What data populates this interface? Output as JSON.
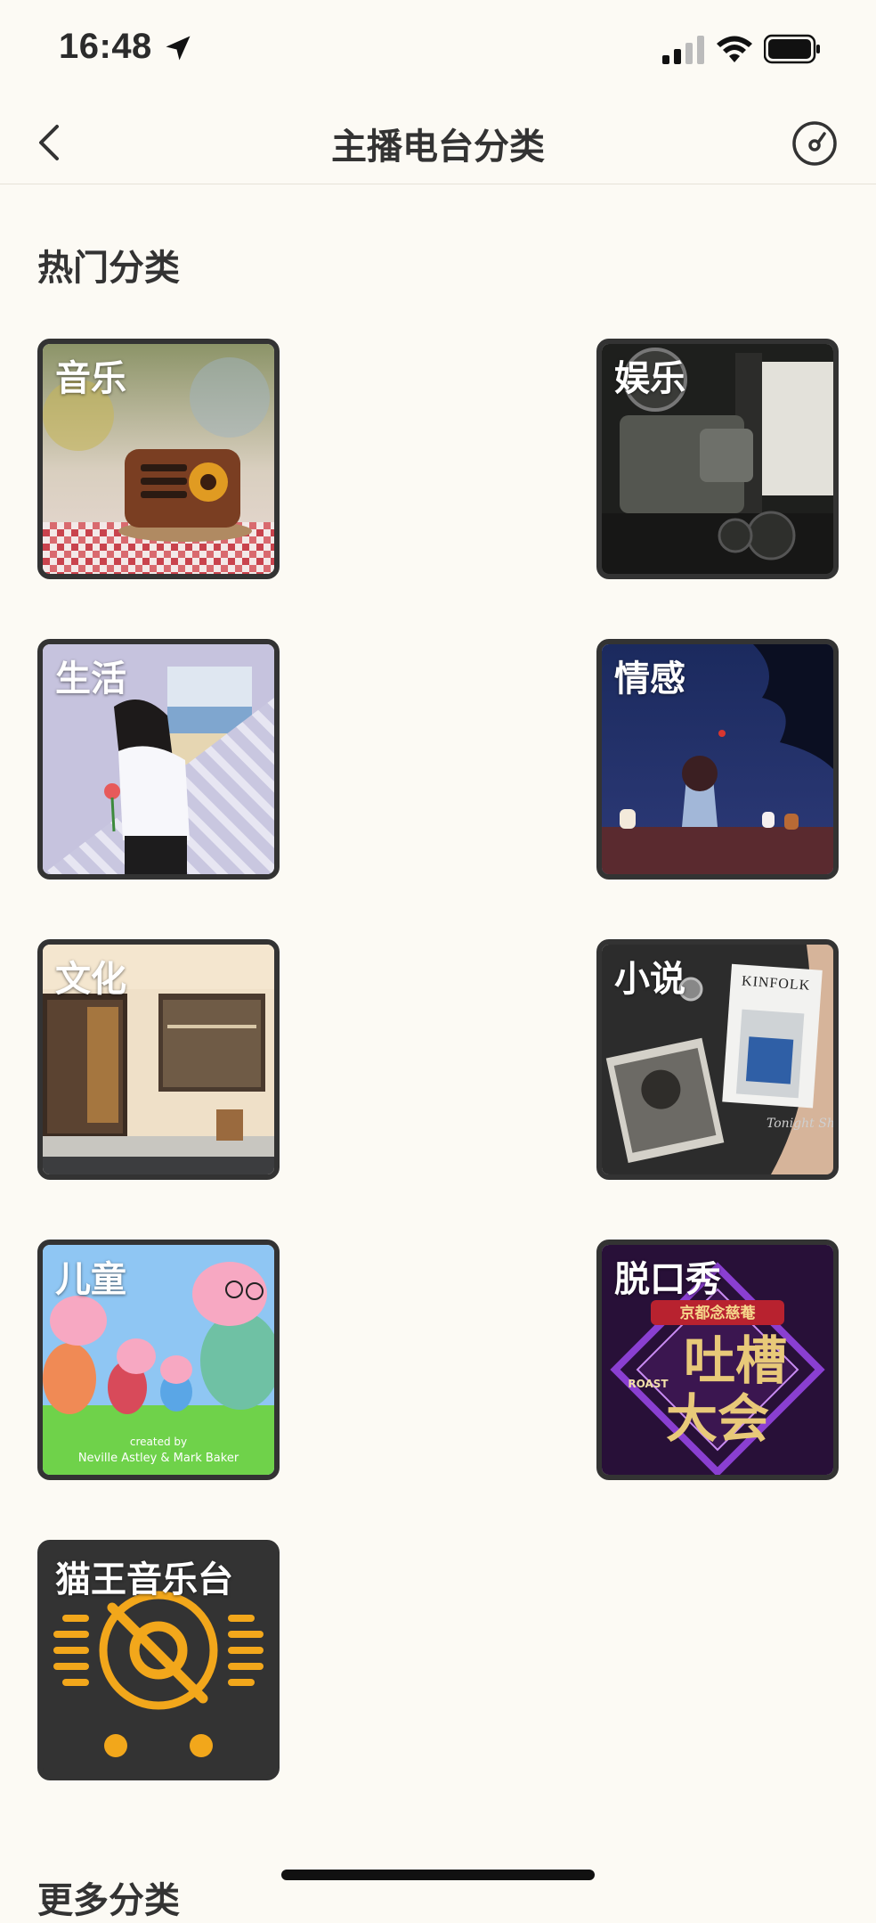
{
  "status_bar": {
    "time": "16:48"
  },
  "nav": {
    "title": "主播电台分类"
  },
  "hot_section": {
    "title": "热门分类",
    "categories": [
      {
        "label": "音乐"
      },
      {
        "label": "娱乐"
      },
      {
        "label": "生活"
      },
      {
        "label": "情感"
      },
      {
        "label": "文化"
      },
      {
        "label": "小说"
      },
      {
        "label": "儿童"
      },
      {
        "label": "脱口秀"
      },
      {
        "label": "猫王音乐台"
      }
    ]
  },
  "artwork_text": {
    "novel_magazine": "KINFOLK",
    "novel_script": "Tonight Shop",
    "kids_credit_1": "created by",
    "kids_credit_2": "Neville Astley & Mark Baker",
    "talkshow_top": "京都念慈菴",
    "talkshow_main_1": "吐槽",
    "talkshow_main_2": "大会",
    "talkshow_roast": "ROAST"
  },
  "more_section": {
    "title": "更多分类"
  },
  "colors": {
    "background": "#fcfaf4",
    "card_border": "#333333",
    "radio_orange": "#f2a71b"
  }
}
